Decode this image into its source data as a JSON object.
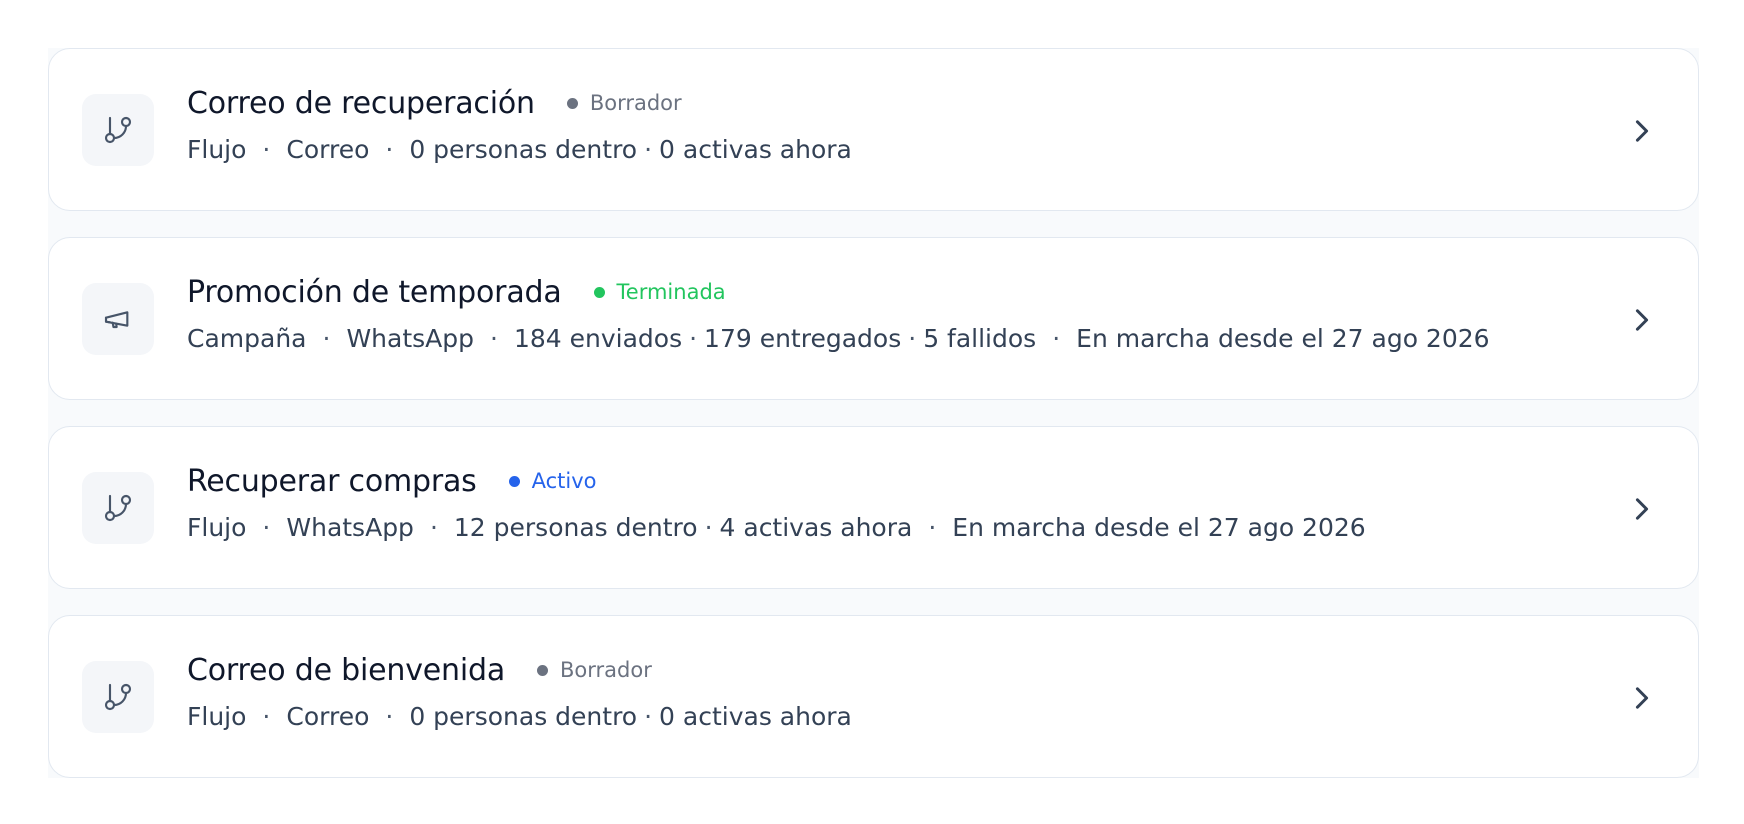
{
  "items": [
    {
      "icon": "git-branch-icon",
      "title": "Correo de recuperación",
      "status": {
        "label": "Borrador",
        "color": "#6b7280"
      },
      "meta": [
        "Flujo",
        "Correo",
        "0 personas dentro",
        "0 activas ahora"
      ]
    },
    {
      "icon": "megaphone-icon",
      "title": "Promoción de temporada",
      "status": {
        "label": "Terminada",
        "color": "#22c55e"
      },
      "meta": [
        "Campaña",
        "WhatsApp",
        "184 enviados",
        "179 entregados",
        "5 fallidos",
        "En marcha desde el 27 ago 2026"
      ]
    },
    {
      "icon": "git-branch-icon",
      "title": "Recuperar compras",
      "status": {
        "label": "Activo",
        "color": "#2563eb"
      },
      "meta": [
        "Flujo",
        "WhatsApp",
        "12 personas dentro",
        "4 activas ahora",
        "En marcha desde el 27 ago 2026"
      ]
    },
    {
      "icon": "git-branch-icon",
      "title": "Correo de bienvenida",
      "status": {
        "label": "Borrador",
        "color": "#6b7280"
      },
      "meta": [
        "Flujo",
        "Correo",
        "0 personas dentro",
        "0 activas ahora"
      ]
    }
  ],
  "icons": {
    "chevron": "chevron-right-icon"
  }
}
